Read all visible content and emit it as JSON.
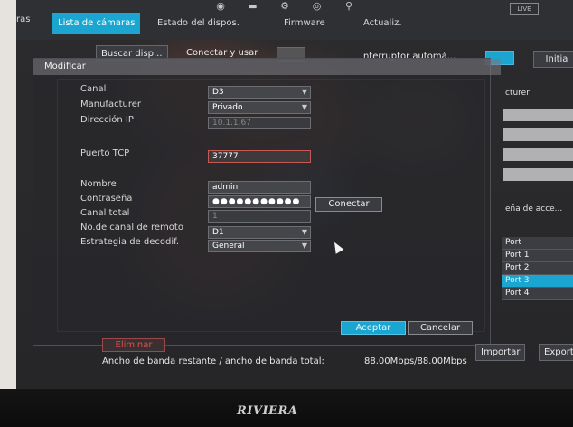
{
  "nav": {
    "left_partial": "ras",
    "tabs": [
      {
        "label": "Lista de cámaras",
        "active": true
      },
      {
        "label": "Estado del dispos.",
        "active": false
      },
      {
        "label": "Firmware",
        "active": false
      },
      {
        "label": "Actualiz.",
        "active": false
      }
    ],
    "live_label": "LIVE",
    "icons": [
      "camera-icon",
      "storage-icon",
      "network-icon",
      "alarm-icon",
      "settings-icon"
    ]
  },
  "toolbar": {
    "buscar": "Buscar disp...",
    "conectar_usar": "Conectar y usar",
    "interruptor": "Interruptor automá...",
    "initia": "Initia"
  },
  "right_panel": {
    "header_partial": "cturer",
    "access_partial": "eña de acce...",
    "ports": [
      "Port",
      "Port 1",
      "Port 2",
      "Port 3",
      "Port 4"
    ],
    "ports_highlight_index": 3
  },
  "dialog": {
    "title": "Modificar",
    "fields": {
      "canal_label": "Canal",
      "canal_value": "D3",
      "manufacturer_label": "Manufacturer",
      "manufacturer_value": "Privado",
      "ip_label": "Dirección IP",
      "ip_value": "10.1.1.67",
      "tcp_label": "Puerto TCP",
      "tcp_value": "37777",
      "nombre_label": "Nombre",
      "nombre_value": "admin",
      "contrasena_label": "Contraseña",
      "contrasena_value": "●●●●●●●●●●●",
      "canal_total_label": "Canal total",
      "canal_total_value": "1",
      "remote_channel_label": "No.de canal de remoto",
      "remote_channel_value": "D1",
      "strategy_label": "Estrategia de decodif.",
      "strategy_value": "General"
    },
    "conectar_button": "Conectar",
    "aceptar_button": "Aceptar",
    "cancelar_button": "Cancelar"
  },
  "bottom": {
    "eliminar": "Eliminar",
    "importar": "Importar",
    "exportar": "Exportar",
    "bandwidth_label": "Ancho de banda restante / ancho de banda total:",
    "bandwidth_value": "88.00Mbps/88.00Mbps"
  },
  "brand": "RIVIERA",
  "colors": {
    "accent": "#1aa6d1",
    "danger": "#e05050",
    "background": "#2a2a2c"
  }
}
